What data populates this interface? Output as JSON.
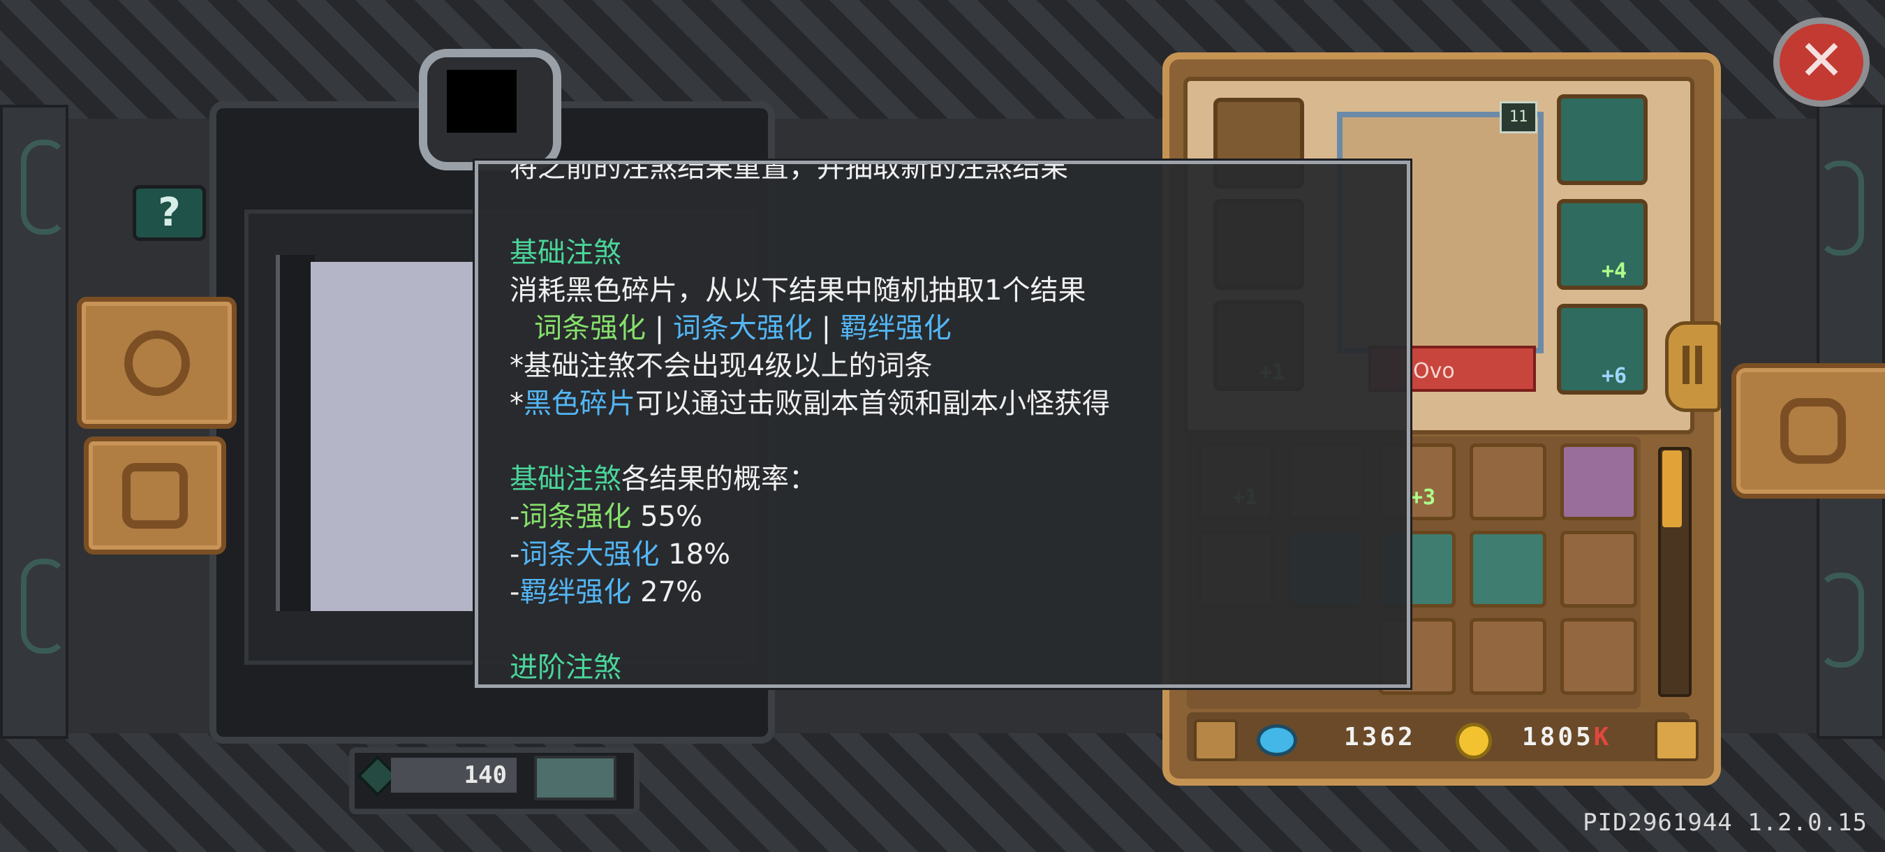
{
  "colors": {
    "formula_green": "#4bd59a",
    "link_blue": "#53b6f5",
    "affix_green": "#86e06c",
    "close_red": "#c33a33",
    "k_red": "#e0473f"
  },
  "help_button": "?",
  "close_icon": "x-close-icon",
  "resource": {
    "count": "140"
  },
  "currency": {
    "gems": "1362",
    "gold": "1805",
    "gold_suffix": "K"
  },
  "character": {
    "name_partial": "Ovo",
    "level_badge": "11"
  },
  "equipment_labels": {
    "plus_4": "+4",
    "plus_6": "+6",
    "plus_1": "+1",
    "plus_3": "+3",
    "plus_1b": "+1"
  },
  "tooltip": {
    "line_top": "将之前的注煞结果重置，并抽取新的注煞结果",
    "basic_title": "基础注煞",
    "basic_desc": "消耗黑色碎片，从以下结果中随机抽取1个结果",
    "options": {
      "opt1": "词条强化",
      "sep1": " | ",
      "opt2": "词条大强化",
      "sep2": " | ",
      "opt3": "羁绊强化"
    },
    "note1": "*基础注煞不会出现4级以上的词条",
    "note2_prefix": "*",
    "note2_link": "黑色碎片",
    "note2_rest": "可以通过击败副本首领和副本小怪获得",
    "prob_title_colored": "基础注煞",
    "prob_title_rest": "各结果的概率：",
    "probs": [
      {
        "dash": "-",
        "name": "词条强化",
        "value": " 55%"
      },
      {
        "dash": "-",
        "name": "词条大强化",
        "value": " 18%"
      },
      {
        "dash": "-",
        "name": "羁绊强化",
        "value": " 27%"
      }
    ],
    "advanced_title": "进阶注煞"
  },
  "version": "PID2961944 1.2.0.15"
}
